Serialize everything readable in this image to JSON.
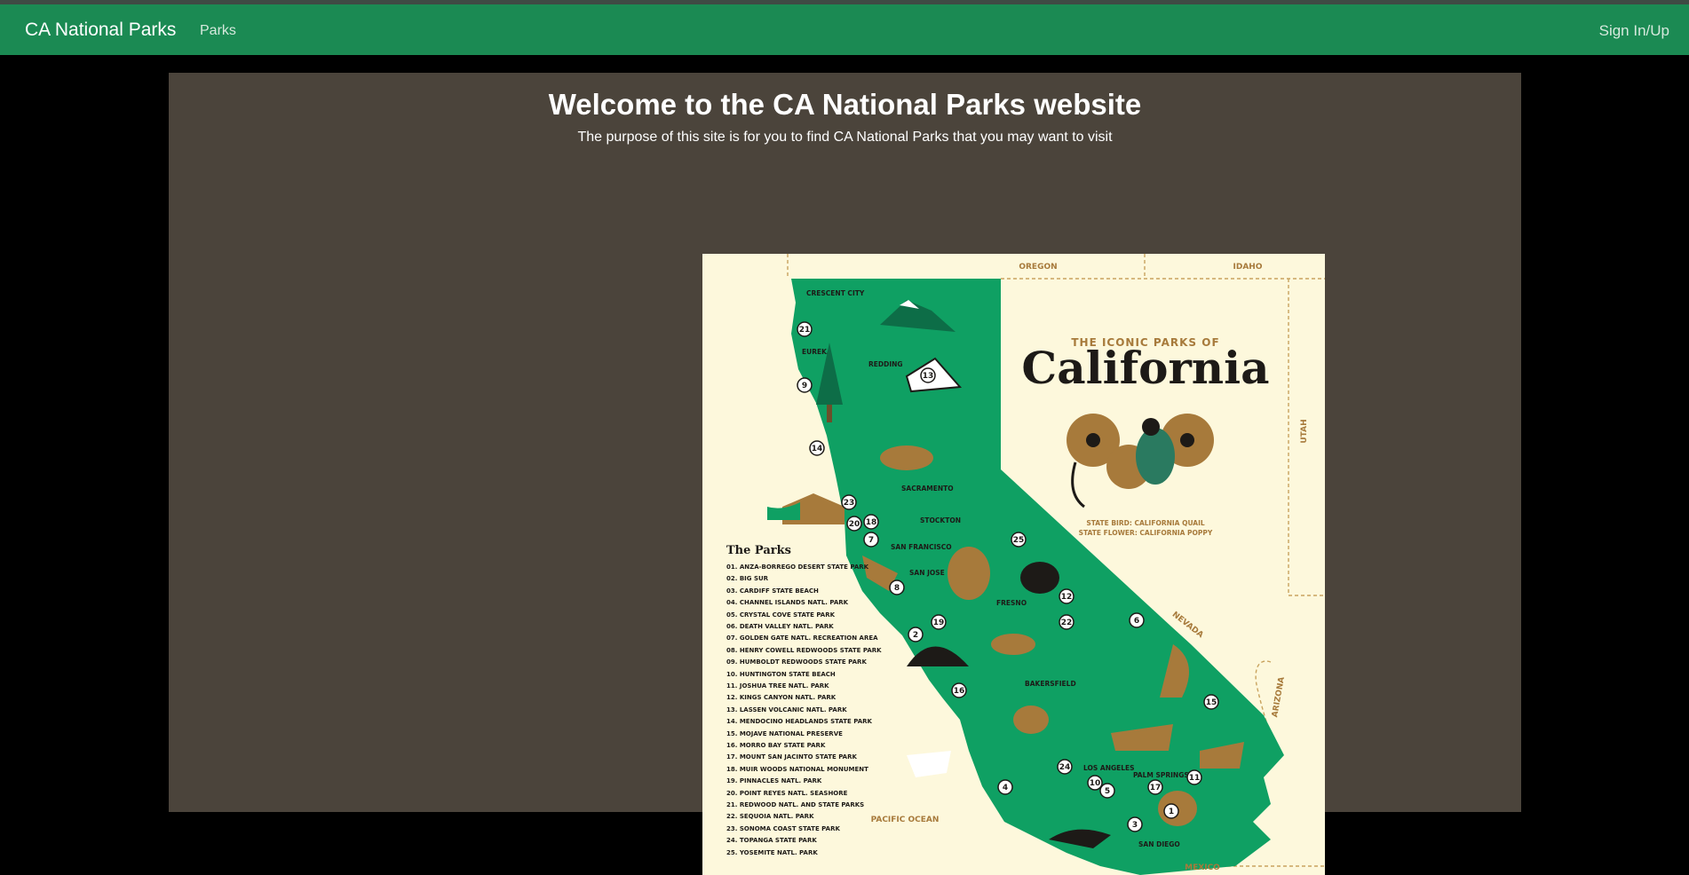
{
  "navbar": {
    "brand": "CA National Parks",
    "links": [
      "Parks"
    ],
    "signin": "Sign In/Up"
  },
  "main": {
    "title": "Welcome to the CA National Parks website",
    "subtitle": "The purpose of this site is for you to find CA National Parks that you may want to visit"
  },
  "map": {
    "kicker": "THE ICONIC PARKS OF",
    "title": "California",
    "state_bird": "STATE BIRD: CALIFORNIA QUAIL",
    "state_flower": "STATE FLOWER: CALIFORNIA POPPY",
    "parks_heading": "The Parks",
    "parks": [
      "01. ANZA-BORREGO DESERT STATE PARK",
      "02. BIG SUR",
      "03. CARDIFF STATE BEACH",
      "04. CHANNEL ISLANDS NATL. PARK",
      "05. CRYSTAL COVE STATE PARK",
      "06. DEATH VALLEY NATL. PARK",
      "07. GOLDEN GATE NATL. RECREATION AREA",
      "08. HENRY COWELL REDWOODS STATE PARK",
      "09. HUMBOLDT REDWOODS STATE PARK",
      "10. HUNTINGTON STATE BEACH",
      "11. JOSHUA TREE NATL. PARK",
      "12. KINGS CANYON NATL. PARK",
      "13. LASSEN VOLCANIC NATL. PARK",
      "14. MENDOCINO HEADLANDS STATE PARK",
      "15. MOJAVE NATIONAL PRESERVE",
      "16. MORRO BAY STATE PARK",
      "17. MOUNT SAN JACINTO STATE PARK",
      "18. MUIR WOODS NATIONAL MONUMENT",
      "19. PINNACLES NATL. PARK",
      "20. POINT REYES NATL. SEASHORE",
      "21. REDWOOD NATL. AND STATE PARKS",
      "22. SEQUOIA NATL. PARK",
      "23. SONOMA COAST STATE PARK",
      "24. TOPANGA STATE PARK",
      "25. YOSEMITE NATL. PARK"
    ],
    "states": {
      "oregon": "OREGON",
      "idaho": "IDAHO",
      "utah": "UTAH",
      "nevada": "NEVADA",
      "arizona": "ARIZONA",
      "mexico": "MEXICO"
    },
    "ocean": "PACIFIC OCEAN",
    "cities": {
      "crescent_city": "CRESCENT CITY",
      "eureka": "EUREKA",
      "redding": "REDDING",
      "sacramento": "SACRAMENTO",
      "stockton": "STOCKTON",
      "san_francisco": "SAN FRANCISCO",
      "san_jose": "SAN JOSE",
      "fresno": "FRESNO",
      "bakersfield": "BAKERSFIELD",
      "los_angeles": "LOS ANGELES",
      "palm_springs": "PALM SPRINGS",
      "san_diego": "SAN DIEGO"
    },
    "markers": [
      "21",
      "9",
      "13",
      "14",
      "23",
      "20",
      "18",
      "7",
      "25",
      "8",
      "19",
      "2",
      "12",
      "22",
      "6",
      "16",
      "15",
      "24",
      "10",
      "5",
      "17",
      "11",
      "1",
      "3",
      "4"
    ],
    "colors": {
      "background": "#fdf8dc",
      "state_fill": "#0fa063",
      "dark": "#1d1a17",
      "brown": "#a77a3b",
      "border_dash": "#c9a35e"
    }
  }
}
